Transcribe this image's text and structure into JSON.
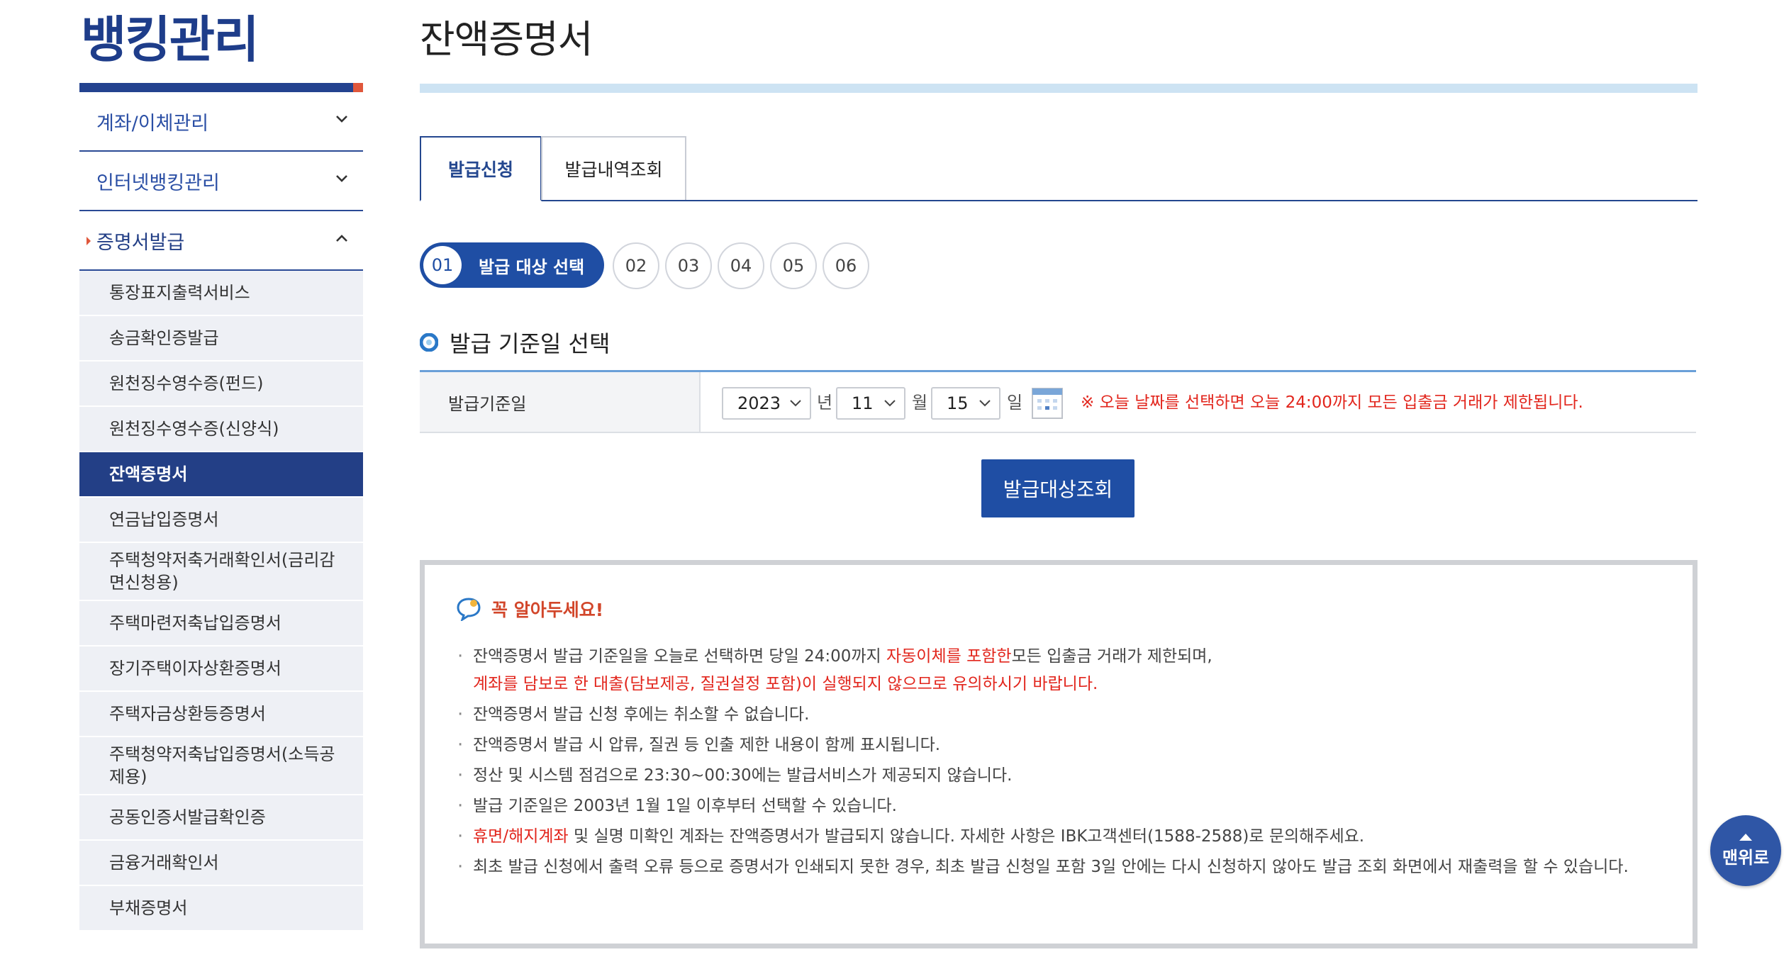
{
  "sidebar": {
    "title": "뱅킹관리",
    "categories": [
      {
        "label": "계좌/이체관리"
      },
      {
        "label": "인터넷뱅킹관리"
      },
      {
        "label": "증명서발급"
      }
    ],
    "items": [
      "통장표지출력서비스",
      "송금확인증발급",
      "원천징수영수증(펀드)",
      "원천징수영수증(신양식)",
      "잔액증명서",
      "연금납입증명서",
      "주택청약저축거래확인서(금리감면신청용)",
      "주택마련저축납입증명서",
      "장기주택이자상환증명서",
      "주택자금상환등증명서",
      "주택청약저축납입증명서(소득공제용)",
      "공동인증서발급확인증",
      "금융거래확인서",
      "부채증명서"
    ]
  },
  "page": {
    "title": "잔액증명서"
  },
  "tabs": [
    "발급신청",
    "발급내역조회"
  ],
  "steps": {
    "active_num": "01",
    "active_label": "발급 대상 선택",
    "others": [
      "02",
      "03",
      "04",
      "05",
      "06"
    ]
  },
  "section": {
    "title": "발급 기준일 선택"
  },
  "form": {
    "label": "발급기준일",
    "year": "2023",
    "year_unit": "년",
    "month": "11",
    "month_unit": "월",
    "day": "15",
    "day_unit": "일",
    "notice": "※ 오늘 날짜를 선택하면 오늘 24:00까지 모든 입출금 거래가 제한됩니다."
  },
  "search_button": "발급대상조회",
  "notice": {
    "heading": "꼭 알아두세요!",
    "l1_a": "잔액증명서 발급 기준일을 오늘로 선택하면 당일 24:00까지 ",
    "l1_red": "자동이체를 포함한",
    "l1_b": "모든 입출금 거래가 제한되며,",
    "l1_line2": "계좌를 담보로 한 대출(담보제공, 질권설정 포함)이 실행되지 않으므로 유의하시기 바랍니다.",
    "l2": "잔액증명서 발급 신청 후에는 취소할 수 없습니다.",
    "l3": "잔액증명서 발급 시 압류, 질권 등 인출 제한 내용이 함께 표시됩니다.",
    "l4": "정산 및 시스템 점검으로 23:30~00:30에는 발급서비스가 제공되지 않습니다.",
    "l5": "발급 기준일은 2003년 1월 1일 이후부터 선택할 수 있습니다.",
    "l6_red": "휴면/해지계좌",
    "l6_b": " 및 실명 미확인 계좌는 잔액증명서가 발급되지 않습니다. 자세한 사항은 IBK고객센터(1588-2588)로 문의해주세요.",
    "l7": "최초 발급 신청에서 출력 오류 등으로 증명서가 인쇄되지 못한 경우, 최초 발급 신청일 포함 3일 안에는 다시 신청하지 않아도 발급 조회 화면에서 재출력을 할 수 있습니다."
  },
  "to_top": "맨위로"
}
